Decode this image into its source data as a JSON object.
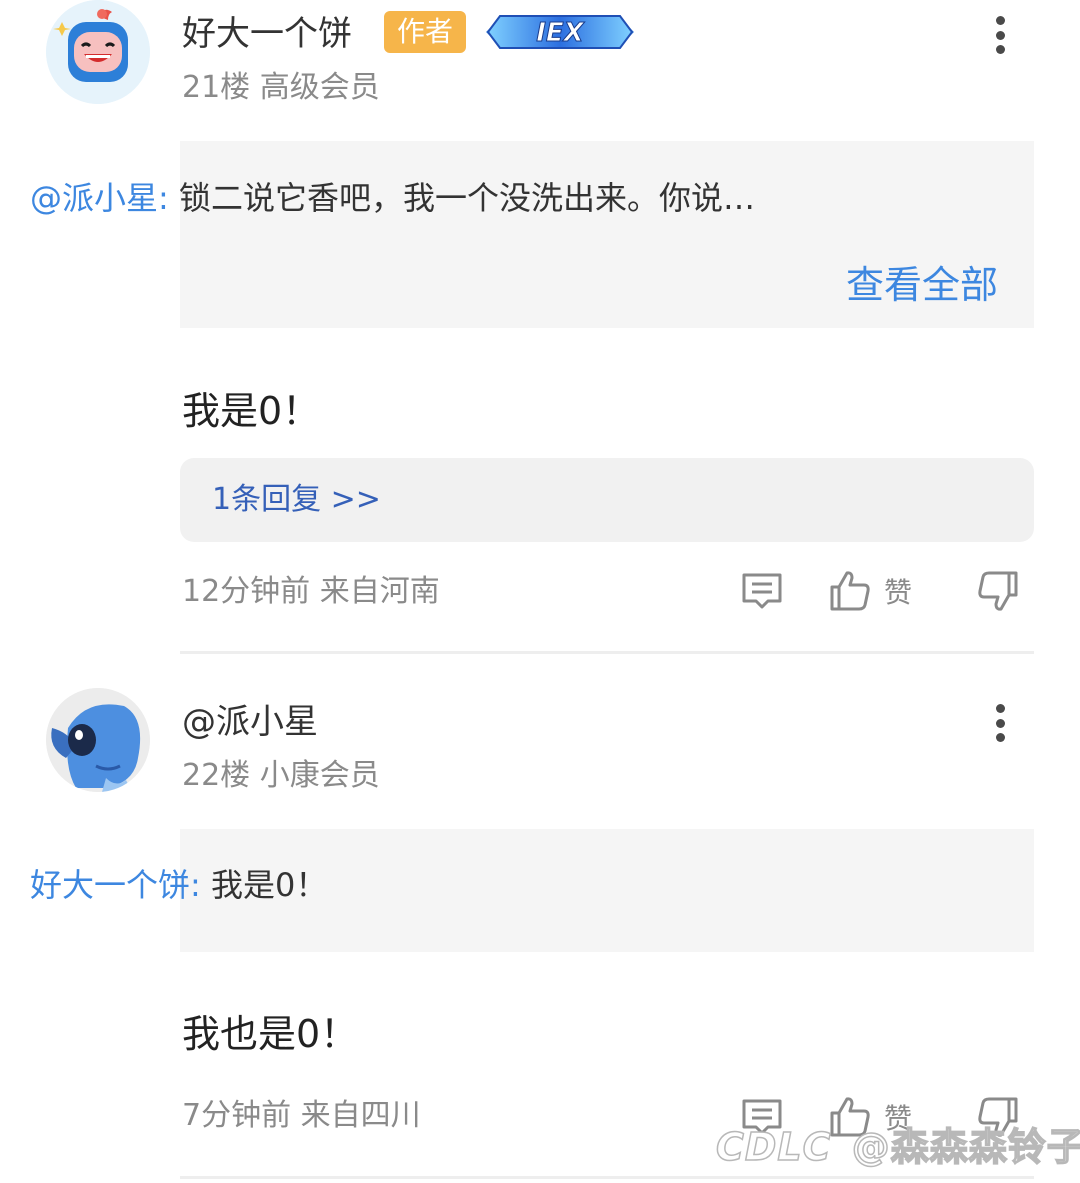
{
  "posts": [
    {
      "username": "好大一个饼",
      "author_badge": "作者",
      "level_badge": "IEX",
      "floor": "21楼",
      "membership": "高级会员",
      "quote_author": "@派小星:",
      "quote_text": "锁二说它香吧，我一个没洗出来。你说…",
      "view_all": "查看全部",
      "content": "我是0！",
      "replies_link": "1条回复 >>",
      "time": "12分钟前",
      "location": "来自河南",
      "like_label": "赞"
    },
    {
      "username": "@派小星",
      "floor": "22楼",
      "membership": "小康会员",
      "quote_author": "好大一个饼:",
      "quote_text": "我是0！",
      "content": "我也是0！",
      "time": "7分钟前",
      "location": "来自四川",
      "like_label": "赞"
    }
  ],
  "watermark": {
    "logo": "CDLC",
    "user": "@森森森铃子"
  },
  "colors": {
    "link": "#3d87e0",
    "reply_link": "#3560b8",
    "author_badge": "#f6b54a",
    "meta": "#8a8a8a"
  },
  "icons": [
    "avatar-cartoon-icon",
    "avatar-stitch-icon",
    "more-vertical-icon",
    "comment-icon",
    "thumbs-up-icon",
    "thumbs-down-icon"
  ]
}
